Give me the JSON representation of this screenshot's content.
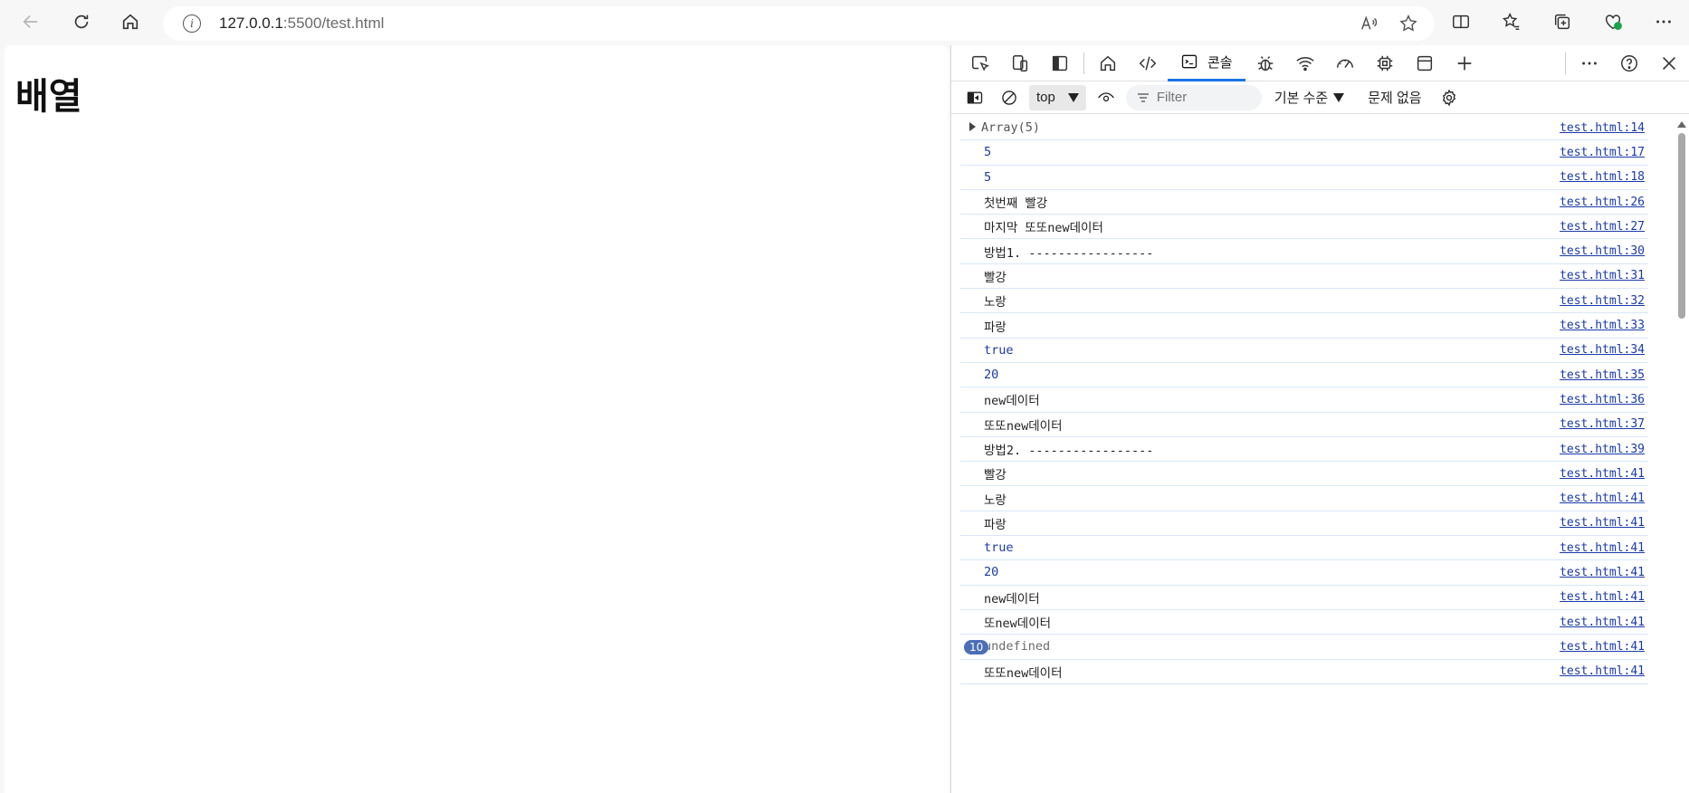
{
  "browser": {
    "url_host": "127.0.0.1",
    "url_path": ":5500/test.html"
  },
  "page": {
    "heading": "배열"
  },
  "devtools": {
    "active_tab": "콘솔",
    "context": "top",
    "filter_placeholder": "Filter",
    "level": "기본 수준",
    "issues": "문제 없음"
  },
  "console": {
    "rows": [
      {
        "type": "obj",
        "text": "Array(5)",
        "src": "test.html:14"
      },
      {
        "type": "num",
        "text": "5",
        "src": "test.html:17"
      },
      {
        "type": "num",
        "text": "5",
        "src": "test.html:18"
      },
      {
        "type": "str",
        "text": "첫번째 빨강",
        "src": "test.html:26"
      },
      {
        "type": "str",
        "text": "마지막 또또new데이터",
        "src": "test.html:27"
      },
      {
        "type": "str",
        "text": "방법1. -----------------",
        "src": "test.html:30"
      },
      {
        "type": "str",
        "text": "빨강",
        "src": "test.html:31"
      },
      {
        "type": "str",
        "text": "노랑",
        "src": "test.html:32"
      },
      {
        "type": "str",
        "text": "파랑",
        "src": "test.html:33"
      },
      {
        "type": "num",
        "text": "true",
        "src": "test.html:34"
      },
      {
        "type": "num",
        "text": "20",
        "src": "test.html:35"
      },
      {
        "type": "str",
        "text": "new데이터",
        "src": "test.html:36"
      },
      {
        "type": "str",
        "text": "또또new데이터",
        "src": "test.html:37"
      },
      {
        "type": "str",
        "text": "방법2. -----------------",
        "src": "test.html:39"
      },
      {
        "type": "str",
        "text": "빨강",
        "src": "test.html:41"
      },
      {
        "type": "str",
        "text": "노랑",
        "src": "test.html:41"
      },
      {
        "type": "str",
        "text": "파랑",
        "src": "test.html:41"
      },
      {
        "type": "num",
        "text": "true",
        "src": "test.html:41"
      },
      {
        "type": "num",
        "text": "20",
        "src": "test.html:41"
      },
      {
        "type": "str",
        "text": "new데이터",
        "src": "test.html:41"
      },
      {
        "type": "str",
        "text": "또new데이터",
        "src": "test.html:41"
      },
      {
        "type": "undef",
        "text": "undefined",
        "badge": "10",
        "src": "test.html:41"
      },
      {
        "type": "str",
        "text": "또또new데이터",
        "src": "test.html:41"
      }
    ]
  },
  "colors": {
    "accent": "#1a73e8",
    "link": "#1a3aa8",
    "badge": "#4a6fb8"
  }
}
